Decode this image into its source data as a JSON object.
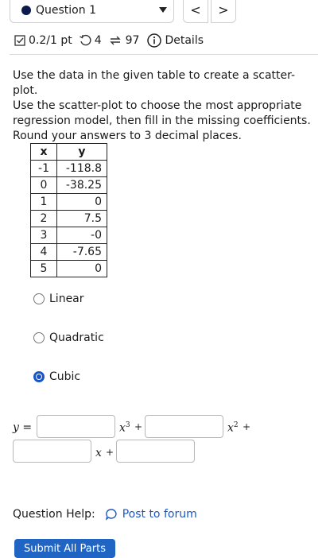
{
  "header": {
    "question_label": "Question 1",
    "prev_label": "<",
    "next_label": ">"
  },
  "meta": {
    "score": "0.2/1 pt",
    "retries": "4",
    "attempts": "97",
    "details_label": "Details"
  },
  "prompt": {
    "line1": "Use the data in the given table to create a scatter-plot.",
    "line2": "Use the scatter-plot to choose the most appropriate",
    "line3": "regression model, then fill in the missing coefficients.",
    "line4": "Round your answers to 3 decimal places."
  },
  "table": {
    "headers": [
      "x",
      "y"
    ],
    "rows": [
      [
        "-1",
        "-118.8"
      ],
      [
        "0",
        "-38.25"
      ],
      [
        "1",
        "0"
      ],
      [
        "2",
        "7.5"
      ],
      [
        "3",
        "-0"
      ],
      [
        "4",
        "-7.65"
      ],
      [
        "5",
        "0"
      ]
    ]
  },
  "options": [
    {
      "label": "Linear",
      "selected": false
    },
    {
      "label": "Quadratic",
      "selected": false
    },
    {
      "label": "Cubic",
      "selected": true
    }
  ],
  "equation": {
    "y_label": "y =",
    "x3_label": "x",
    "x3_sup": "3",
    "x2_label": "x",
    "x2_sup": "2",
    "x1_label": "x",
    "plus": "+"
  },
  "help": {
    "label": "Question Help:",
    "forum_link": "Post to forum"
  },
  "submit_label": "Submit All Parts",
  "colors": {
    "accent": "#1a55c8",
    "submit_bg": "#2165c4",
    "question_dot": "#0d1a4d"
  }
}
